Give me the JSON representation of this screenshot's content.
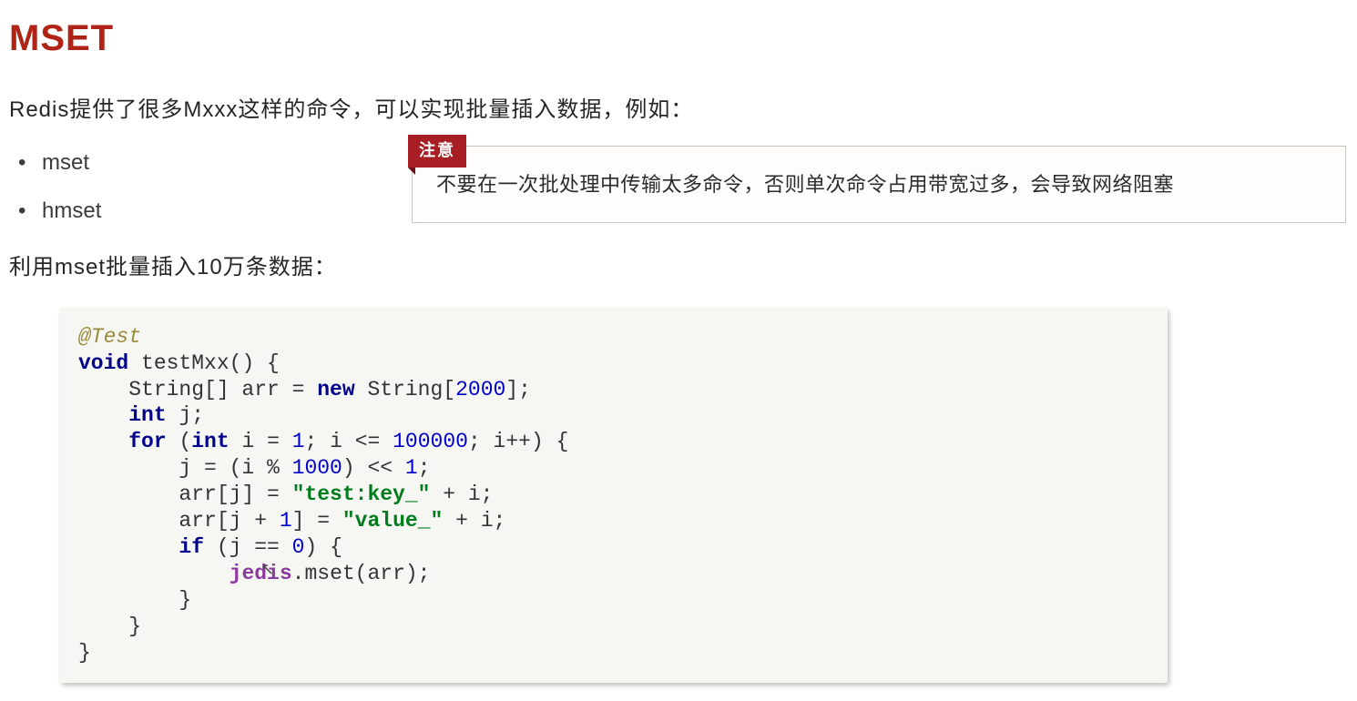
{
  "title": "MSET",
  "intro": "Redis提供了很多Mxxx这样的命令，可以实现批量插入数据，例如：",
  "bullets": [
    "mset",
    "hmset"
  ],
  "subtext": "利用mset批量插入10万条数据：",
  "callout": {
    "tag": "注意",
    "text": "不要在一次批处理中传输太多命令，否则单次命令占用带宽过多，会导致网络阻塞"
  },
  "code": {
    "annotation": "@Test",
    "kw_void": "void",
    "fn_decl": " testMxx() {",
    "line_arr_pre": "    String[] arr = ",
    "kw_new": "new",
    "line_arr_mid": " String[",
    "num_2000": "2000",
    "line_arr_end": "];",
    "kw_int": "int",
    "line_intj": " j;",
    "kw_for": "for",
    "for_open": " (",
    "kw_int2": "int",
    "for_init": " i = ",
    "num_1": "1",
    "for_cond": "; i <= ",
    "num_100000": "100000",
    "for_inc": "; i++) {",
    "line_j_pre": "        j = (i % ",
    "num_1000": "1000",
    "line_j_mid": ") << ",
    "num_1b": "1",
    "line_j_end": ";",
    "line_arrj_pre": "        arr[j] = ",
    "str_test_key": "\"test:key_\"",
    "line_arrj_end": " + i;",
    "line_arrj1_pre": "        arr[j + ",
    "num_1c": "1",
    "line_arrj1_mid": "] = ",
    "str_value": "\"value_\"",
    "line_arrj1_end": " + i;",
    "kw_if": "if",
    "if_open": " (j == ",
    "num_0": "0",
    "if_close": ") {",
    "field_jedis": "jedis",
    "jedis_call": ".mset(arr);",
    "indent_jedis": "            ",
    "close_if": "        }",
    "close_for": "    }",
    "close_fn": "}"
  }
}
